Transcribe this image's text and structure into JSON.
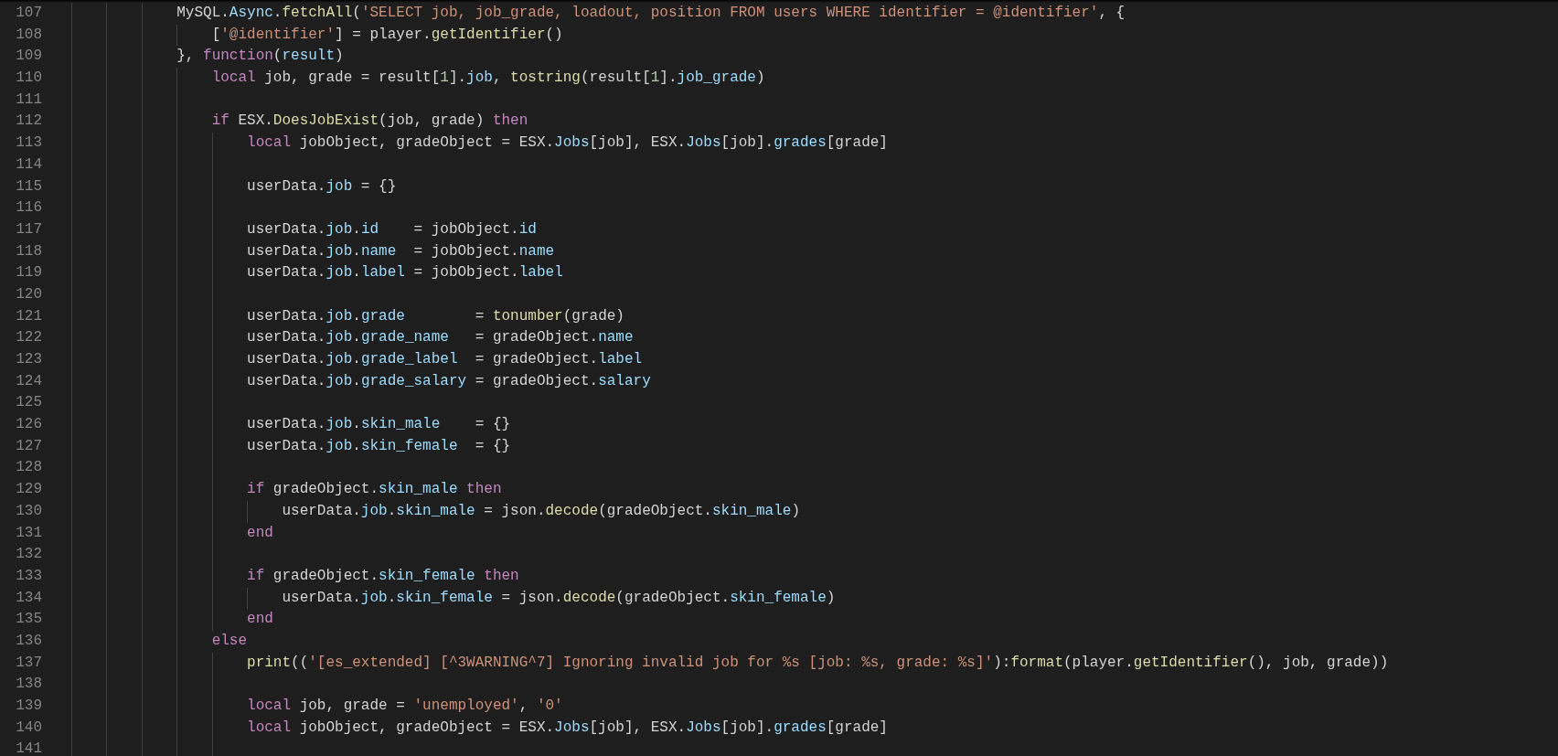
{
  "editor": {
    "lines": [
      {
        "number": "107",
        "tokens": [
          {
            "kind": "plain",
            "text": "            MySQL."
          },
          {
            "kind": "property",
            "text": "Async"
          },
          {
            "kind": "plain",
            "text": "."
          },
          {
            "kind": "function",
            "text": "fetchAll"
          },
          {
            "kind": "plain",
            "text": "("
          },
          {
            "kind": "string",
            "text": "'SELECT job, job_grade, loadout, position FROM users WHERE identifier = @identifier'"
          },
          {
            "kind": "plain",
            "text": ", {"
          }
        ]
      },
      {
        "number": "108",
        "tokens": [
          {
            "kind": "plain",
            "text": "                ["
          },
          {
            "kind": "string",
            "text": "'@identifier'"
          },
          {
            "kind": "plain",
            "text": "] = player."
          },
          {
            "kind": "function",
            "text": "getIdentifier"
          },
          {
            "kind": "plain",
            "text": "()"
          }
        ]
      },
      {
        "number": "109",
        "tokens": [
          {
            "kind": "plain",
            "text": "            }, "
          },
          {
            "kind": "keyword",
            "text": "function"
          },
          {
            "kind": "plain",
            "text": "("
          },
          {
            "kind": "property",
            "text": "result"
          },
          {
            "kind": "plain",
            "text": ")"
          }
        ]
      },
      {
        "number": "110",
        "tokens": [
          {
            "kind": "keyword",
            "text": "                local"
          },
          {
            "kind": "plain",
            "text": " job, grade = result["
          },
          {
            "kind": "number",
            "text": "1"
          },
          {
            "kind": "plain",
            "text": "]."
          },
          {
            "kind": "property",
            "text": "job"
          },
          {
            "kind": "plain",
            "text": ", "
          },
          {
            "kind": "function",
            "text": "tostring"
          },
          {
            "kind": "plain",
            "text": "(result["
          },
          {
            "kind": "number",
            "text": "1"
          },
          {
            "kind": "plain",
            "text": "]."
          },
          {
            "kind": "property",
            "text": "job_grade"
          },
          {
            "kind": "plain",
            "text": ")"
          }
        ]
      },
      {
        "number": "111"
      },
      {
        "number": "112",
        "tokens": [
          {
            "kind": "keyword",
            "text": "                if"
          },
          {
            "kind": "plain",
            "text": " ESX."
          },
          {
            "kind": "function",
            "text": "DoesJobExist"
          },
          {
            "kind": "plain",
            "text": "(job, grade) "
          },
          {
            "kind": "keyword",
            "text": "then"
          }
        ]
      },
      {
        "number": "113",
        "tokens": [
          {
            "kind": "keyword",
            "text": "                    local"
          },
          {
            "kind": "plain",
            "text": " jobObject, gradeObject = ESX."
          },
          {
            "kind": "property",
            "text": "Jobs"
          },
          {
            "kind": "plain",
            "text": "[job], ESX."
          },
          {
            "kind": "property",
            "text": "Jobs"
          },
          {
            "kind": "plain",
            "text": "[job]."
          },
          {
            "kind": "property",
            "text": "grades"
          },
          {
            "kind": "plain",
            "text": "[grade]"
          }
        ]
      },
      {
        "number": "114"
      },
      {
        "number": "115",
        "tokens": [
          {
            "kind": "plain",
            "text": "                    userData."
          },
          {
            "kind": "property",
            "text": "job"
          },
          {
            "kind": "plain",
            "text": " = {}"
          }
        ]
      },
      {
        "number": "116"
      },
      {
        "number": "117",
        "tokens": [
          {
            "kind": "plain",
            "text": "                    userData."
          },
          {
            "kind": "property",
            "text": "job"
          },
          {
            "kind": "plain",
            "text": "."
          },
          {
            "kind": "property",
            "text": "id"
          },
          {
            "kind": "plain",
            "text": "    = jobObject."
          },
          {
            "kind": "property",
            "text": "id"
          }
        ]
      },
      {
        "number": "118",
        "tokens": [
          {
            "kind": "plain",
            "text": "                    userData."
          },
          {
            "kind": "property",
            "text": "job"
          },
          {
            "kind": "plain",
            "text": "."
          },
          {
            "kind": "property",
            "text": "name"
          },
          {
            "kind": "plain",
            "text": "  = jobObject."
          },
          {
            "kind": "property",
            "text": "name"
          }
        ]
      },
      {
        "number": "119",
        "tokens": [
          {
            "kind": "plain",
            "text": "                    userData."
          },
          {
            "kind": "property",
            "text": "job"
          },
          {
            "kind": "plain",
            "text": "."
          },
          {
            "kind": "property",
            "text": "label"
          },
          {
            "kind": "plain",
            "text": " = jobObject."
          },
          {
            "kind": "property",
            "text": "label"
          }
        ]
      },
      {
        "number": "120"
      },
      {
        "number": "121",
        "tokens": [
          {
            "kind": "plain",
            "text": "                    userData."
          },
          {
            "kind": "property",
            "text": "job"
          },
          {
            "kind": "plain",
            "text": "."
          },
          {
            "kind": "property",
            "text": "grade"
          },
          {
            "kind": "plain",
            "text": "        = "
          },
          {
            "kind": "function",
            "text": "tonumber"
          },
          {
            "kind": "plain",
            "text": "(grade)"
          }
        ]
      },
      {
        "number": "122",
        "tokens": [
          {
            "kind": "plain",
            "text": "                    userData."
          },
          {
            "kind": "property",
            "text": "job"
          },
          {
            "kind": "plain",
            "text": "."
          },
          {
            "kind": "property",
            "text": "grade_name"
          },
          {
            "kind": "plain",
            "text": "   = gradeObject."
          },
          {
            "kind": "property",
            "text": "name"
          }
        ]
      },
      {
        "number": "123",
        "tokens": [
          {
            "kind": "plain",
            "text": "                    userData."
          },
          {
            "kind": "property",
            "text": "job"
          },
          {
            "kind": "plain",
            "text": "."
          },
          {
            "kind": "property",
            "text": "grade_label"
          },
          {
            "kind": "plain",
            "text": "  = gradeObject."
          },
          {
            "kind": "property",
            "text": "label"
          }
        ]
      },
      {
        "number": "124",
        "tokens": [
          {
            "kind": "plain",
            "text": "                    userData."
          },
          {
            "kind": "property",
            "text": "job"
          },
          {
            "kind": "plain",
            "text": "."
          },
          {
            "kind": "property",
            "text": "grade_salary"
          },
          {
            "kind": "plain",
            "text": " = gradeObject."
          },
          {
            "kind": "property",
            "text": "salary"
          }
        ]
      },
      {
        "number": "125"
      },
      {
        "number": "126",
        "tokens": [
          {
            "kind": "plain",
            "text": "                    userData."
          },
          {
            "kind": "property",
            "text": "job"
          },
          {
            "kind": "plain",
            "text": "."
          },
          {
            "kind": "property",
            "text": "skin_male"
          },
          {
            "kind": "plain",
            "text": "    = {}"
          }
        ]
      },
      {
        "number": "127",
        "tokens": [
          {
            "kind": "plain",
            "text": "                    userData."
          },
          {
            "kind": "property",
            "text": "job"
          },
          {
            "kind": "plain",
            "text": "."
          },
          {
            "kind": "property",
            "text": "skin_female"
          },
          {
            "kind": "plain",
            "text": "  = {}"
          }
        ]
      },
      {
        "number": "128"
      },
      {
        "number": "129",
        "tokens": [
          {
            "kind": "keyword",
            "text": "                    if"
          },
          {
            "kind": "plain",
            "text": " gradeObject."
          },
          {
            "kind": "property",
            "text": "skin_male"
          },
          {
            "kind": "keyword",
            "text": " then"
          }
        ]
      },
      {
        "number": "130",
        "tokens": [
          {
            "kind": "plain",
            "text": "                        userData."
          },
          {
            "kind": "property",
            "text": "job"
          },
          {
            "kind": "plain",
            "text": "."
          },
          {
            "kind": "property",
            "text": "skin_male"
          },
          {
            "kind": "plain",
            "text": " = json."
          },
          {
            "kind": "function",
            "text": "decode"
          },
          {
            "kind": "plain",
            "text": "(gradeObject."
          },
          {
            "kind": "property",
            "text": "skin_male"
          },
          {
            "kind": "plain",
            "text": ")"
          }
        ]
      },
      {
        "number": "131",
        "tokens": [
          {
            "kind": "keyword",
            "text": "                    end"
          }
        ]
      },
      {
        "number": "132"
      },
      {
        "number": "133",
        "tokens": [
          {
            "kind": "keyword",
            "text": "                    if"
          },
          {
            "kind": "plain",
            "text": " gradeObject."
          },
          {
            "kind": "property",
            "text": "skin_female"
          },
          {
            "kind": "keyword",
            "text": " then"
          }
        ]
      },
      {
        "number": "134",
        "tokens": [
          {
            "kind": "plain",
            "text": "                        userData."
          },
          {
            "kind": "property",
            "text": "job"
          },
          {
            "kind": "plain",
            "text": "."
          },
          {
            "kind": "property",
            "text": "skin_female"
          },
          {
            "kind": "plain",
            "text": " = json."
          },
          {
            "kind": "function",
            "text": "decode"
          },
          {
            "kind": "plain",
            "text": "(gradeObject."
          },
          {
            "kind": "property",
            "text": "skin_female"
          },
          {
            "kind": "plain",
            "text": ")"
          }
        ]
      },
      {
        "number": "135",
        "tokens": [
          {
            "kind": "keyword",
            "text": "                    end"
          }
        ]
      },
      {
        "number": "136",
        "tokens": [
          {
            "kind": "keyword",
            "text": "                else"
          }
        ]
      },
      {
        "number": "137",
        "tokens": [
          {
            "kind": "function",
            "text": "                    print"
          },
          {
            "kind": "plain",
            "text": "(("
          },
          {
            "kind": "string",
            "text": "'[es_extended] [^3WARNING^7] Ignoring invalid job for %s [job: %s, grade: %s]'"
          },
          {
            "kind": "plain",
            "text": "):"
          },
          {
            "kind": "function",
            "text": "format"
          },
          {
            "kind": "plain",
            "text": "(player."
          },
          {
            "kind": "function",
            "text": "getIdentifier"
          },
          {
            "kind": "plain",
            "text": "(), job, grade))"
          }
        ]
      },
      {
        "number": "138"
      },
      {
        "number": "139",
        "tokens": [
          {
            "kind": "keyword",
            "text": "                    local"
          },
          {
            "kind": "plain",
            "text": " job, grade = "
          },
          {
            "kind": "string",
            "text": "'unemployed'"
          },
          {
            "kind": "plain",
            "text": ", "
          },
          {
            "kind": "string",
            "text": "'0'"
          }
        ]
      },
      {
        "number": "140",
        "tokens": [
          {
            "kind": "keyword",
            "text": "                    local"
          },
          {
            "kind": "plain",
            "text": " jobObject, gradeObject = ESX."
          },
          {
            "kind": "property",
            "text": "Jobs"
          },
          {
            "kind": "plain",
            "text": "[job], ESX."
          },
          {
            "kind": "property",
            "text": "Jobs"
          },
          {
            "kind": "plain",
            "text": "[job]."
          },
          {
            "kind": "property",
            "text": "grades"
          },
          {
            "kind": "plain",
            "text": "[grade]"
          }
        ]
      },
      {
        "number": "141"
      }
    ]
  }
}
